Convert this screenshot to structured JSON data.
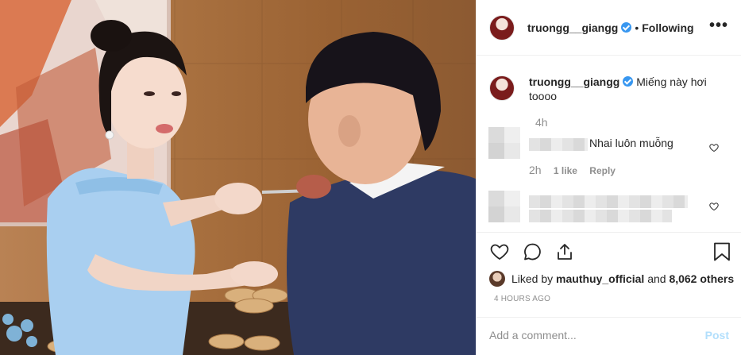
{
  "header": {
    "username": "truongg__giangg",
    "separator": "•",
    "follow_status": "Following",
    "more_label": "•••"
  },
  "caption": {
    "username": "truongg__giangg",
    "text": "Miếng này hơi toooo",
    "time": "4h"
  },
  "comments": [
    {
      "text": "Nhai luôn muỗng",
      "time": "2h",
      "likes": "1 like",
      "reply": "Reply"
    },
    {
      "text": "",
      "time": "",
      "likes": "",
      "reply": ""
    }
  ],
  "likes": {
    "prefix": "Liked by",
    "user": "mauthuy_official",
    "middle": "and",
    "count": "8,062 others"
  },
  "posted_ago": "4 HOURS AGO",
  "add_comment": {
    "placeholder": "Add a comment...",
    "post_label": "Post"
  },
  "colors": {
    "link_blue": "#3897f0",
    "post_disabled": "#b2dffc",
    "muted": "#8e8e8e",
    "text": "#262626"
  }
}
